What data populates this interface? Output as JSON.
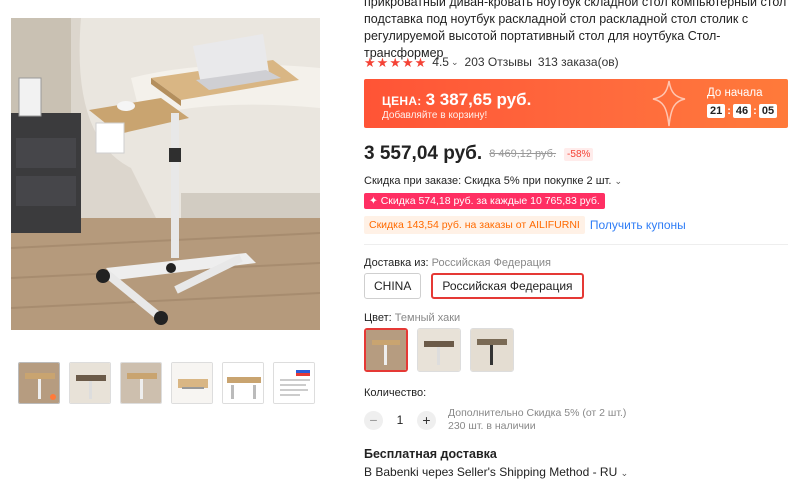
{
  "product": {
    "title": "прикроватный диван-кровать ноутбук  складной стол компьютерный стол подставка под ноутбук раскладной стол раскладной стол столик с регулируемой высотой портативный стол для ноутбука Стол-трансформер"
  },
  "rating": {
    "stars": 5,
    "value": "4.5",
    "reviews": "203 Отзывы",
    "orders": "313 заказа(ов)"
  },
  "promo": {
    "price_label": "ЦЕНА:",
    "price": "3 387,65 руб.",
    "subtext": "Добавляйте в корзину!",
    "timer_label": "До начала",
    "timer": {
      "h": "21",
      "m": "46",
      "s": "05"
    }
  },
  "price": {
    "current": "3 557,04 руб.",
    "old": "8 469,12 руб.",
    "discount": "-58%"
  },
  "discounts": {
    "order_discount": "Скидка при заказе: Скидка 5% при покупке 2 шт.",
    "per_amount": "✦ Скидка 574,18 руб. за каждые 10 765,83 руб.",
    "coupon": "Скидка 143,54 руб. на заказы от AILIFURNI",
    "coupon_link": "Получить купоны"
  },
  "shipping_from": {
    "label": "Доставка из:",
    "selected": "Российская Федерация",
    "options": [
      "CHINA",
      "Российская Федерация"
    ]
  },
  "color": {
    "label": "Цвет:",
    "selected": "Темный хаки"
  },
  "quantity": {
    "label": "Количество:",
    "value": "1",
    "minus": "−",
    "plus": "+",
    "extra_discount": "Дополнительно Скидка 5% (от 2 шт.)",
    "stock": "230 шт. в наличии"
  },
  "delivery": {
    "title": "Бесплатная доставка",
    "method": "В Babenki через Seller's Shipping Method - RU"
  },
  "colors": {
    "accent_red": "#e53935",
    "promo_orange": "#ff5436",
    "pink_tag": "#ff2f63",
    "link_blue": "#2f7df6"
  }
}
